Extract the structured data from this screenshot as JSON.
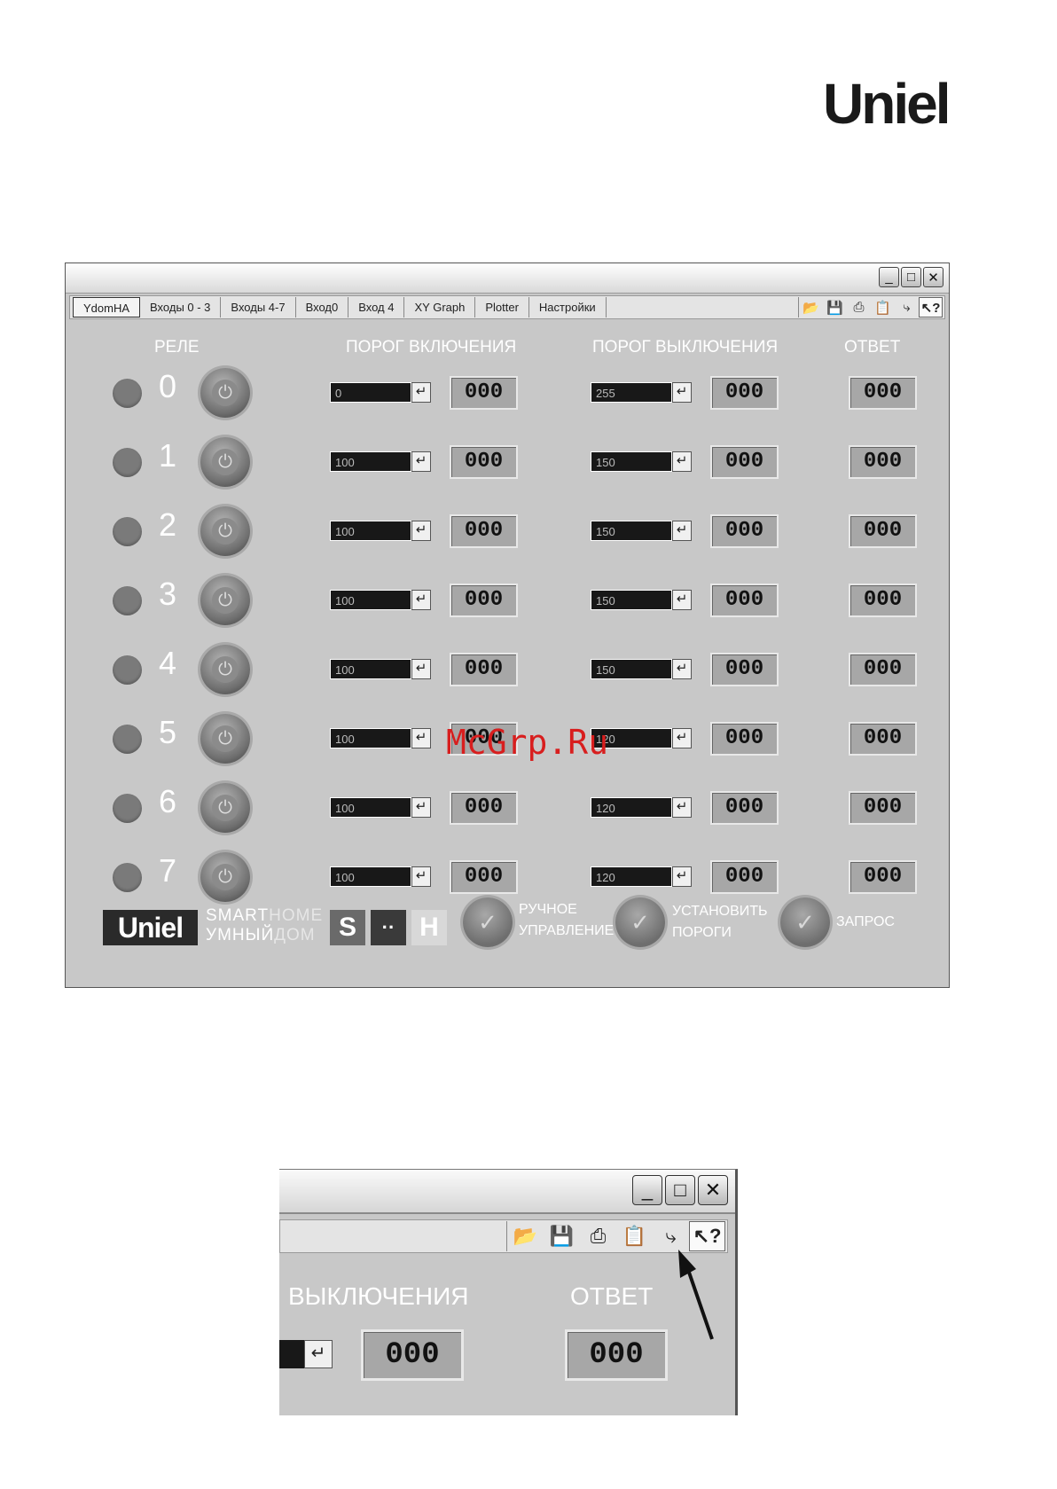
{
  "brand": {
    "logo_text": "Uniel"
  },
  "window": {
    "controls": {
      "minimize": "_",
      "maximize": "□",
      "close": "✕"
    },
    "tabs": [
      {
        "label": "YdomHA",
        "active": true
      },
      {
        "label": "Входы 0 - 3"
      },
      {
        "label": "Входы 4-7"
      },
      {
        "label": "Вход0"
      },
      {
        "label": "Вход 4"
      },
      {
        "label": "XY Graph"
      },
      {
        "label": "Plotter"
      },
      {
        "label": "Настройки"
      }
    ],
    "tools": [
      "open-folder-icon",
      "save-icon",
      "print-icon",
      "clipboard-icon",
      "connect-icon",
      "help-pointer-icon"
    ],
    "headers": {
      "relay": "РЕЛЕ",
      "on_threshold": "ПОРОГ ВКЛЮЧЕНИЯ",
      "off_threshold": "ПОРОГ ВЫКЛЮЧЕНИЯ",
      "response": "ОТВЕТ"
    },
    "enter_symbol": "↵",
    "rows": [
      {
        "num": "0",
        "on_input": "0",
        "on_disp": "000",
        "off_input": "255",
        "off_disp": "000",
        "resp": "000"
      },
      {
        "num": "1",
        "on_input": "100",
        "on_disp": "000",
        "off_input": "150",
        "off_disp": "000",
        "resp": "000"
      },
      {
        "num": "2",
        "on_input": "100",
        "on_disp": "000",
        "off_input": "150",
        "off_disp": "000",
        "resp": "000"
      },
      {
        "num": "3",
        "on_input": "100",
        "on_disp": "000",
        "off_input": "150",
        "off_disp": "000",
        "resp": "000"
      },
      {
        "num": "4",
        "on_input": "100",
        "on_disp": "000",
        "off_input": "150",
        "off_disp": "000",
        "resp": "000"
      },
      {
        "num": "5",
        "on_input": "100",
        "on_disp": "000",
        "off_input": "120",
        "off_disp": "000",
        "resp": "000"
      },
      {
        "num": "6",
        "on_input": "100",
        "on_disp": "000",
        "off_input": "120",
        "off_disp": "000",
        "resp": "000"
      },
      {
        "num": "7",
        "on_input": "100",
        "on_disp": "000",
        "off_input": "120",
        "off_disp": "000",
        "resp": "000"
      }
    ],
    "footer": {
      "logo": "Uniel",
      "smart": "SMART",
      "home": "HOME",
      "umniy": "УМНЫЙ",
      "dom": "ДОМ",
      "s": "S",
      "dots": "··",
      "h": "H",
      "manual_line1": "РУЧНОЕ",
      "manual_line2": "УПРАВЛЕНИЕ",
      "set_line1": "УСТАНОВИТЬ",
      "set_line2": "ПОРОГИ",
      "request": "ЗАПРОС"
    }
  },
  "watermark": "McGrp.Ru",
  "zoom": {
    "header_off": "ВЫКЛЮЧЕНИЯ",
    "header_resp": "ОТВЕТ",
    "disp1": "000",
    "disp2": "000"
  }
}
